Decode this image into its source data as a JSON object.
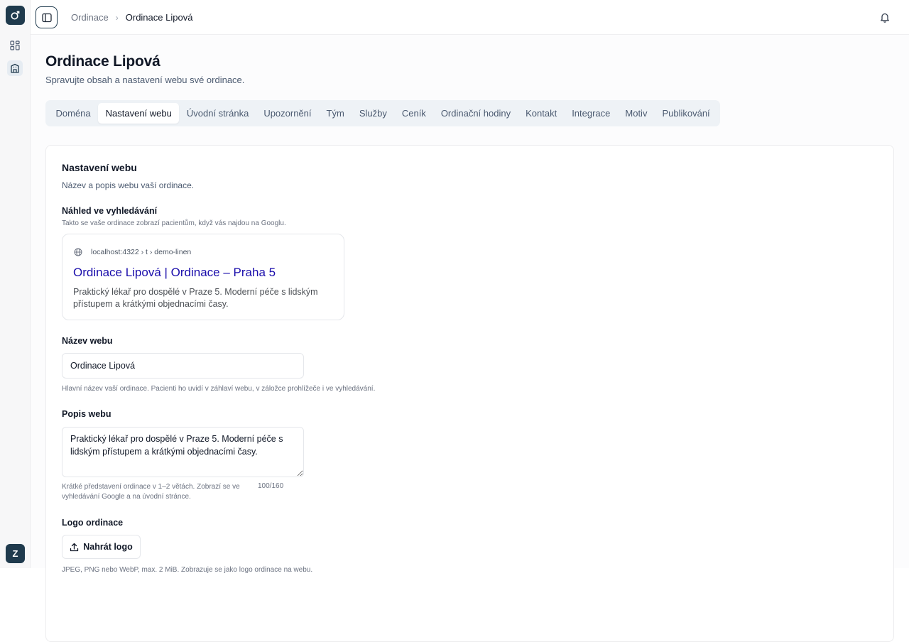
{
  "rail": {
    "avatar_initial": "Z",
    "accent_color": "#1f3a4d"
  },
  "breadcrumb": {
    "parent": "Ordinace",
    "separator": "›",
    "current": "Ordinace Lipová"
  },
  "page": {
    "title": "Ordinace Lipová",
    "subtitle": "Spravujte obsah a nastavení webu své ordinace."
  },
  "tabs": [
    {
      "label": "Doména",
      "active": false
    },
    {
      "label": "Nastavení webu",
      "active": true
    },
    {
      "label": "Úvodní stránka",
      "active": false
    },
    {
      "label": "Upozornění",
      "active": false
    },
    {
      "label": "Tým",
      "active": false
    },
    {
      "label": "Služby",
      "active": false
    },
    {
      "label": "Ceník",
      "active": false
    },
    {
      "label": "Ordinační hodiny",
      "active": false
    },
    {
      "label": "Kontakt",
      "active": false
    },
    {
      "label": "Integrace",
      "active": false
    },
    {
      "label": "Motiv",
      "active": false
    },
    {
      "label": "Publikování",
      "active": false
    }
  ],
  "section": {
    "title": "Nastavení webu",
    "description": "Název a popis webu vaší ordinace."
  },
  "preview": {
    "label": "Náhled ve vyhledávání",
    "hint": "Takto se vaše ordinace zobrazí pacientům, když vás najdou na Googlu.",
    "url": "localhost:4322 › t › demo-linen",
    "title": "Ordinace Lipová | Ordinace – Praha 5",
    "description": "Praktický lékař pro dospělé v Praze 5. Moderní péče s lidským přístupem a krátkými objednacími časy.",
    "title_color": "#1a0dab"
  },
  "site_name": {
    "label": "Název webu",
    "value": "Ordinace Lipová",
    "hint": "Hlavní název vaší ordinace. Pacienti ho uvidí v záhlaví webu, v záložce prohlížeče i ve vyhledávání."
  },
  "site_description": {
    "label": "Popis webu",
    "value": "Praktický lékař pro dospělé v Praze 5. Moderní péče s lidským přístupem a krátkými objednacími časy.",
    "hint": "Krátké představení ordinace v 1–2 větách. Zobrazí se ve vyhledávání Google a na úvodní stránce.",
    "counter": "100/160"
  },
  "logo": {
    "label": "Logo ordinace",
    "button_label": "Nahrát logo",
    "hint": "JPEG, PNG nebo WebP, max. 2 MiB. Zobrazuje se jako logo ordinace na webu."
  }
}
